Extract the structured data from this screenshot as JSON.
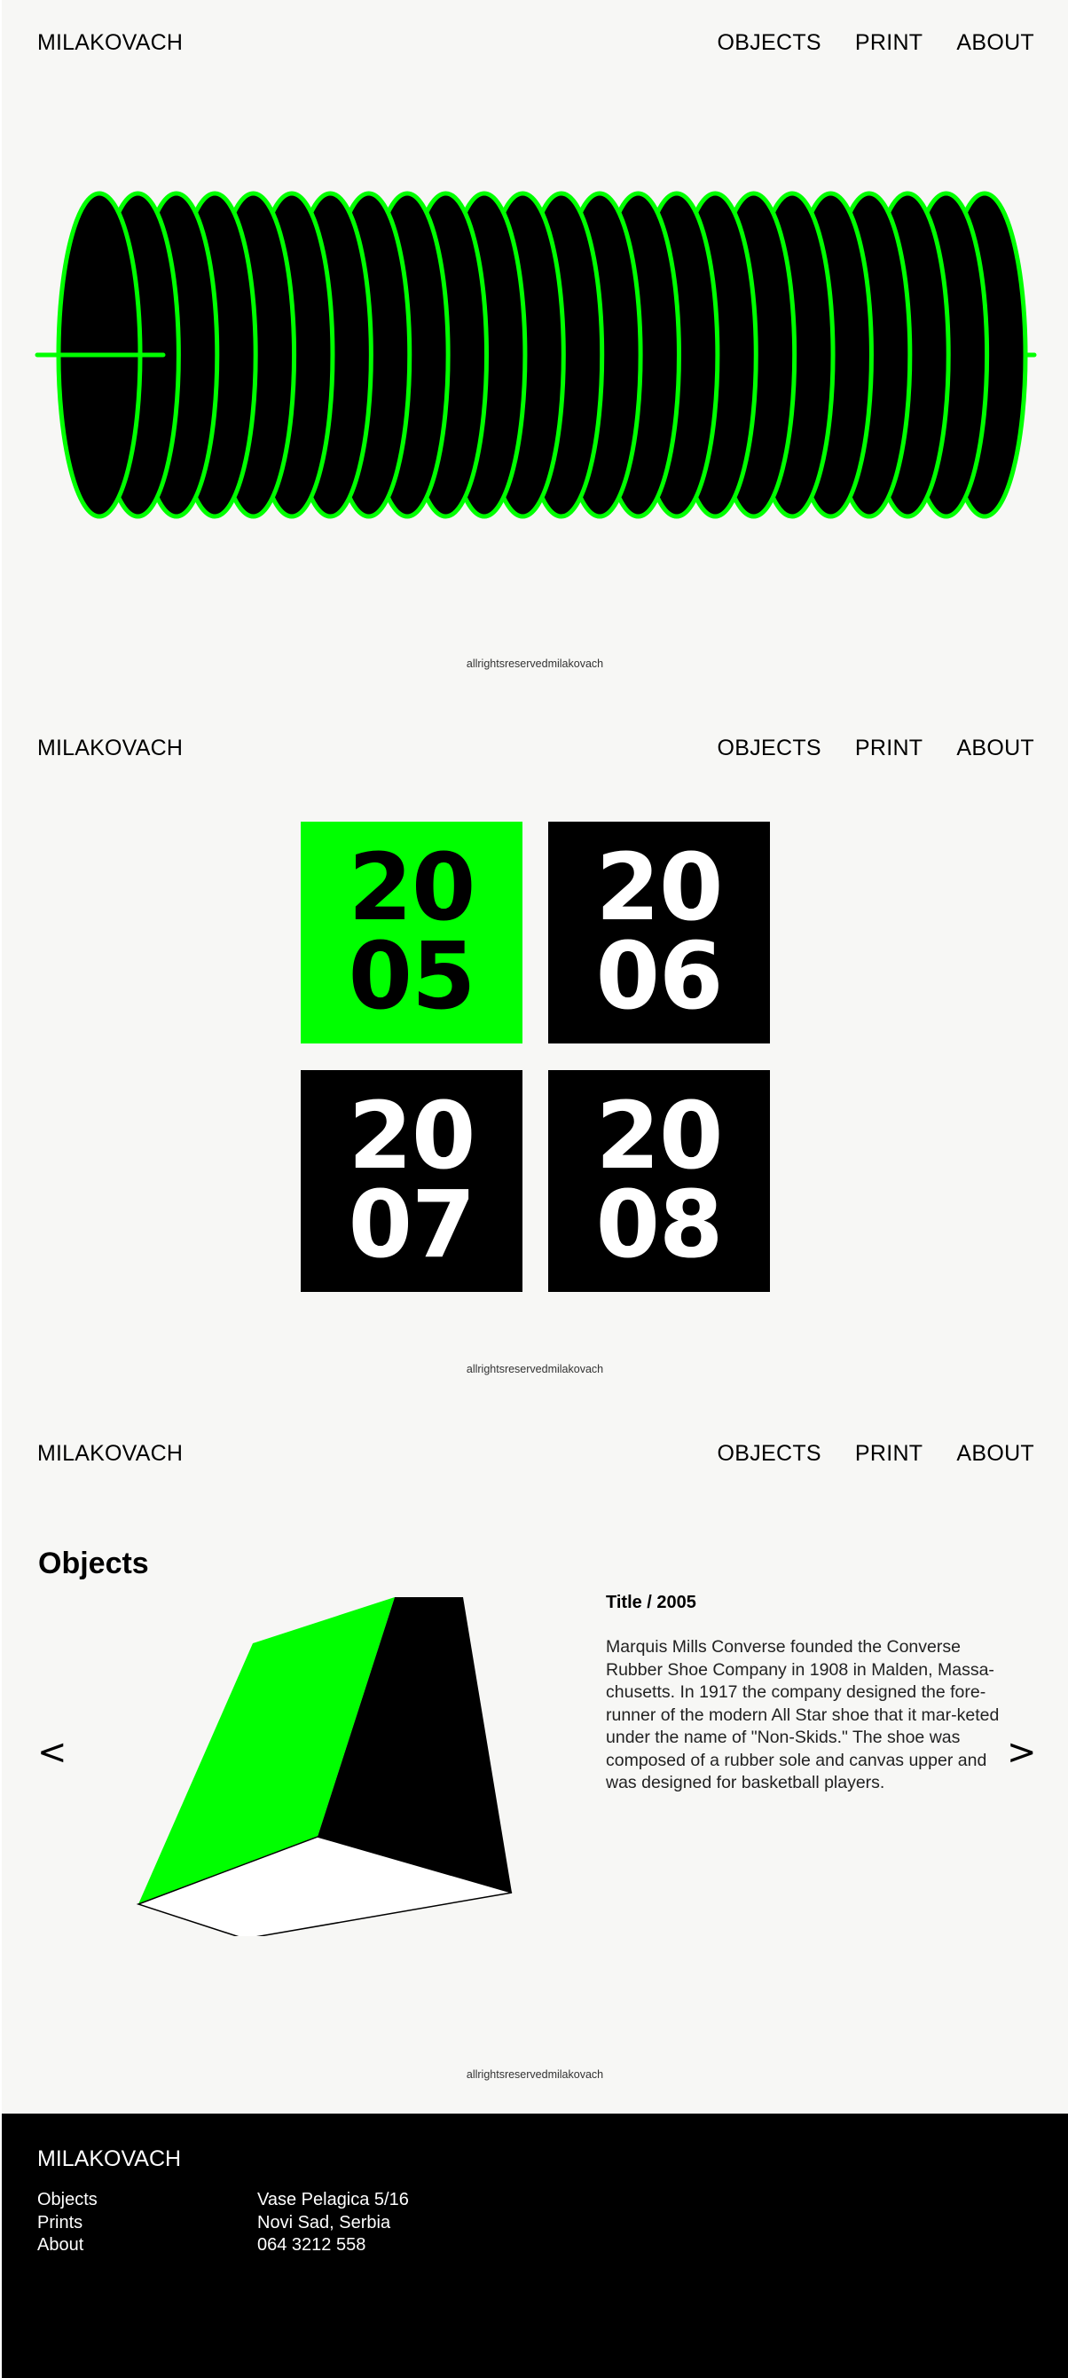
{
  "brand": "MILAKOVACH",
  "nav": {
    "objects": "OBJECTS",
    "print": "PRINT",
    "about": "ABOUT"
  },
  "copyright": "allrightsreservedmilakovach",
  "colors": {
    "accent": "#00ff00",
    "background": "#f7f7f5",
    "ink": "#000000"
  },
  "hero": {
    "graphic": "coil-illustration",
    "ring_count": 24
  },
  "years": [
    {
      "top": "20",
      "bottom": "05",
      "active": true
    },
    {
      "top": "20",
      "bottom": "06",
      "active": false
    },
    {
      "top": "20",
      "bottom": "07",
      "active": false
    },
    {
      "top": "20",
      "bottom": "08",
      "active": false
    }
  ],
  "objects": {
    "heading": "Objects",
    "prev": "<",
    "next": ">",
    "item_title": "Title / 2005",
    "description": "Marquis Mills Converse founded the Converse Rubber Shoe Company in 1908 in Malden, Massa-chusetts. In 1917 the company designed the fore-runner of the modern All Star shoe that it mar-keted under the name of \"Non-Skids.\" The shoe was composed of a rubber sole and canvas upper and was designed for basketball players."
  },
  "footer": {
    "brand": "MILAKOVACH",
    "links": [
      "Objects",
      "Prints",
      "About"
    ],
    "contact": [
      "Vase Pelagica 5/16",
      "Novi Sad, Serbia",
      "064 3212 558"
    ]
  }
}
